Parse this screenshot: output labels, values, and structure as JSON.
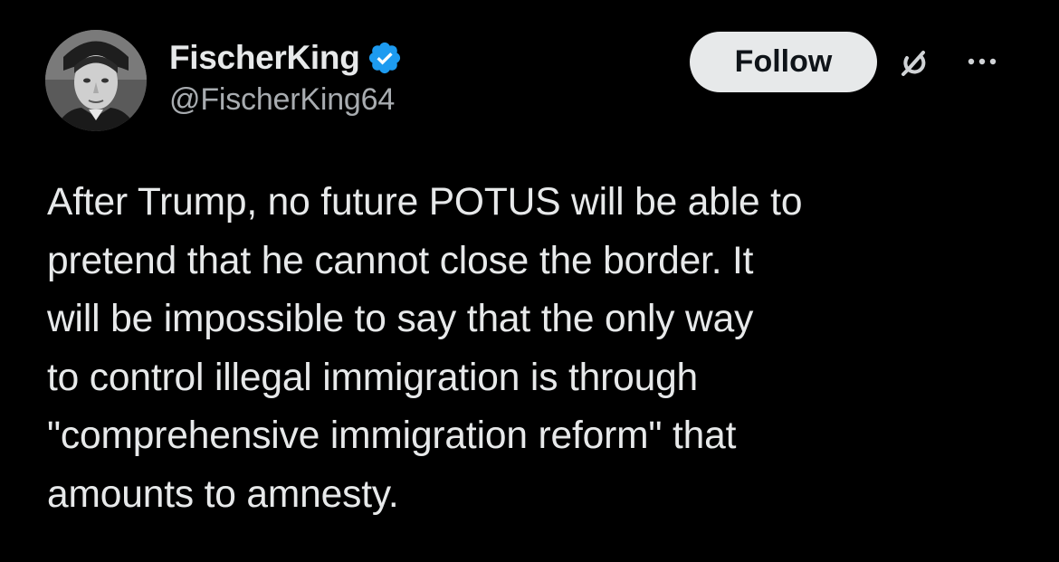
{
  "tweet": {
    "author": {
      "display_name": "FischerKing",
      "handle": "@FischerKing64",
      "verified": true,
      "avatar_icon": "profile-photo"
    },
    "actions": {
      "follow_label": "Follow",
      "grok_icon": "grok-icon",
      "more_icon": "more-icon"
    },
    "text": "After Trump, no future POTUS will be able to\npretend that he cannot close the border. It\nwill be impossible to say that the only way\nto control illegal immigration is through\n\"comprehensive immigration reform\" that\namounts to amnesty."
  },
  "colors": {
    "background": "#000000",
    "text_primary": "#e7e9ea",
    "text_secondary": "#a8acb0",
    "verified_badge": "#1d9bf0",
    "follow_bg": "#e7e9ea",
    "follow_text": "#0f1419"
  }
}
